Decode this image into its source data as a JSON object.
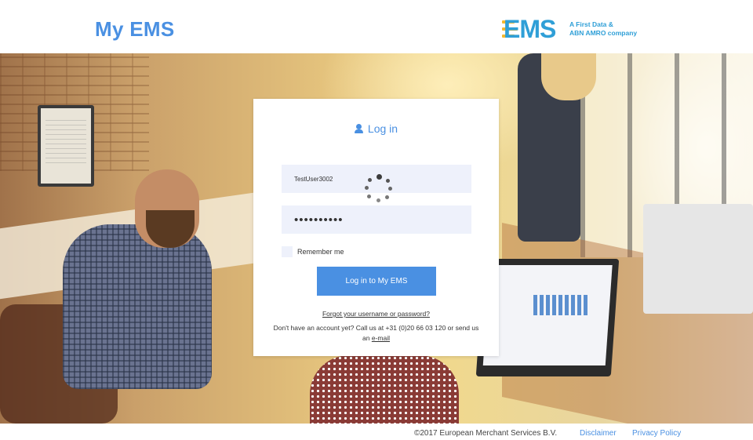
{
  "header": {
    "title": "My EMS",
    "logo": {
      "wordmark": "EMS",
      "tagline_line1": "A First Data &",
      "tagline_line2": "ABN AMRO company",
      "accent_color": "#f5b82e",
      "brand_color": "#2f9fd7"
    }
  },
  "login": {
    "title": "Log in",
    "title_icon": "user-icon",
    "username_value": "TestUser3002",
    "password_value": "••••••••••",
    "loading_indicator": "spinner-icon",
    "remember_label": "Remember me",
    "remember_checked": false,
    "submit_label": "Log in to My EMS",
    "forgot_link": "Forgot your username or password?",
    "no_account_text": "Don't have an account yet? Call us at +31 (0)20 66 03 120 or send us an",
    "email_link": "e-mail"
  },
  "footer": {
    "copyright": "©2017 European Merchant Services B.V.",
    "disclaimer": "Disclaimer",
    "privacy": "Privacy Policy"
  },
  "colors": {
    "primary": "#4a90e2",
    "field_bg": "#eef1fb"
  }
}
